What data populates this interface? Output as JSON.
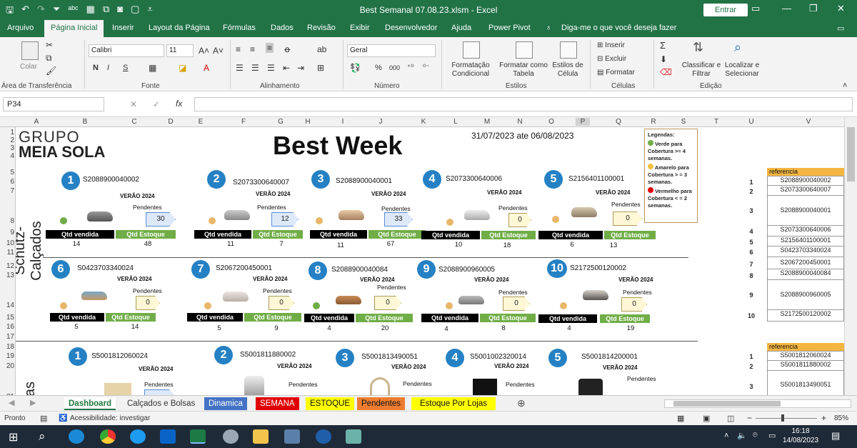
{
  "window": {
    "title": "Best Semanal 07.08.23.xlsm  -  Excel",
    "signin_label": "Entrar"
  },
  "ribbon_tabs": [
    "Arquivo",
    "Página Inicial",
    "Inserir",
    "Layout da Página",
    "Fórmulas",
    "Dados",
    "Revisão",
    "Exibir",
    "Desenvolvedor",
    "Ajuda",
    "Power Pivot"
  ],
  "ribbon_search": "Diga-me o que você deseja fazer",
  "ribbon": {
    "clipboard": {
      "paste_label": "Colar",
      "group": "Área de Transferência"
    },
    "font": {
      "name": "Calibri",
      "size": "11",
      "group": "Fonte",
      "bold": "N",
      "italic": "I",
      "underline": "S"
    },
    "alignment": {
      "group": "Alinhamento"
    },
    "number": {
      "format": "Geral",
      "percent": "%",
      "thousands": "000",
      "group": "Número"
    },
    "styles": {
      "cond_format": "Formatação Condicional",
      "format_table": "Formatar como Tabela",
      "cell_styles": "Estilos de Célula",
      "group": "Estilos"
    },
    "cells": {
      "insert": "Inserir",
      "delete": "Excluir",
      "format": "Formatar",
      "group": "Células"
    },
    "editing": {
      "sort": "Classificar e Filtrar",
      "find": "Localizar e Selecionar",
      "group": "Edição"
    }
  },
  "formula_bar": {
    "name_box": "P34",
    "fx": "fx",
    "content": ""
  },
  "columns": [
    "A",
    "B",
    "C",
    "D",
    "E",
    "F",
    "G",
    "H",
    "I",
    "J",
    "K",
    "L",
    "M",
    "N",
    "O",
    "P",
    "Q",
    "R",
    "S",
    "T",
    "U",
    "V"
  ],
  "rows": [
    "1",
    "2",
    "3",
    "4",
    "5",
    "6",
    "7",
    "8",
    "9",
    "10",
    "11",
    "12",
    "13",
    "14",
    "15",
    "16",
    "17",
    "18",
    "19",
    "20",
    "21"
  ],
  "dashboard": {
    "brand_line1": "GRUPO",
    "brand_line2": "MEIA SOLA",
    "title": "Best Week",
    "period": "31/07/2023 ate 06/08/2023",
    "section_label": "Schutz- Calçados",
    "section_label_bags": "as",
    "legend": {
      "title": "Legendas:",
      "green": "Verde para Cobertura >= 4 semanas.",
      "yellow": "Amarelo para Cobertura > = 3 semanas.",
      "red": "Vermelho para Cobertura < = 2 semanas.",
      "green_color": "#70ad47",
      "yellow_color": "#f5c141",
      "red_color": "#e00000"
    },
    "labels": {
      "verao": "VERÃO 2024",
      "pendentes": "Pendentes",
      "qtd_vendida": "Qtd vendida",
      "qtd_estoque": "Qtd Estoque"
    },
    "shoes_row1": [
      {
        "rank": "1",
        "code": "S2088900040002",
        "pendentes": "30",
        "vendida": "14",
        "estoque": "48",
        "dot": "#70ad47"
      },
      {
        "rank": "2",
        "code": "S2073300640007",
        "pendentes": "12",
        "vendida": "11",
        "estoque": "7",
        "dot": "#e8b76a"
      },
      {
        "rank": "3",
        "code": "S2088900040001",
        "pendentes": "33",
        "vendida": "11",
        "estoque": "67",
        "dot": "#e8b76a"
      },
      {
        "rank": "4",
        "code": "S2073300640006",
        "pendentes": "0",
        "vendida": "10",
        "estoque": "18",
        "dot": "#e8b76a"
      },
      {
        "rank": "5",
        "code": "S2156401100001",
        "pendentes": "0",
        "vendida": "6",
        "estoque": "13",
        "dot": "#e8b76a"
      }
    ],
    "shoes_row2": [
      {
        "rank": "6",
        "code": "S0423703340024",
        "pendentes": "0",
        "vendida": "5",
        "estoque": "14",
        "dot": "#e8b76a"
      },
      {
        "rank": "7",
        "code": "S2067200450001",
        "pendentes": "0",
        "vendida": "5",
        "estoque": "9",
        "dot": "#e8b76a"
      },
      {
        "rank": "8",
        "code": "S2088900040084",
        "pendentes": "0",
        "vendida": "4",
        "estoque": "20",
        "dot": "#70ad47"
      },
      {
        "rank": "9",
        "code": "S2088900960005",
        "pendentes": "0",
        "vendida": "4",
        "estoque": "8",
        "dot": "#e8b76a"
      },
      {
        "rank": "10",
        "code": "S2172500120002",
        "pendentes": "0",
        "vendida": "4",
        "estoque": "19",
        "dot": "#e8b76a"
      }
    ],
    "bags_row1": [
      {
        "rank": "1",
        "code": "S5001812060024"
      },
      {
        "rank": "2",
        "code": "S5001811880002"
      },
      {
        "rank": "3",
        "code": "S5001813490051"
      },
      {
        "rank": "4",
        "code": "S5001002320014"
      },
      {
        "rank": "5",
        "code": "S5001814200001"
      }
    ],
    "ref_table_1": {
      "header": "referencia",
      "rows": [
        {
          "i": "1",
          "ref": "S2088900040002"
        },
        {
          "i": "2",
          "ref": "S2073300640007"
        },
        {
          "i": "3",
          "ref": "S2088900040001"
        },
        {
          "i": "4",
          "ref": "S2073300640006"
        },
        {
          "i": "5",
          "ref": "S2156401100001"
        },
        {
          "i": "6",
          "ref": "S0423703340024"
        },
        {
          "i": "7",
          "ref": "S2067200450001"
        },
        {
          "i": "8",
          "ref": "S2088900040084"
        },
        {
          "i": "9",
          "ref": "S2088900960005"
        },
        {
          "i": "10",
          "ref": "S2172500120002"
        }
      ]
    },
    "ref_table_2": {
      "header": "referencia",
      "rows": [
        {
          "i": "1",
          "ref": "S5001812060024"
        },
        {
          "i": "2",
          "ref": "S5001811880002"
        },
        {
          "i": "3",
          "ref": "S5001813490051"
        }
      ]
    }
  },
  "sheet_tabs": [
    {
      "label": "Dashboard",
      "bg": "#ffffff",
      "fg": "#1e7a3c"
    },
    {
      "label": "Calçados e Bolsas",
      "bg": "#f1f1f1",
      "fg": "#333333"
    },
    {
      "label": "Dinamica",
      "bg": "#4472c4",
      "fg": "#ffffff"
    },
    {
      "label": "SEMANA",
      "bg": "#e00000",
      "fg": "#ffffff"
    },
    {
      "label": "ESTOQUE",
      "bg": "#ffff00",
      "fg": "#111111"
    },
    {
      "label": "Pendentes",
      "bg": "#ed7d31",
      "fg": "#111111"
    },
    {
      "label": "Estoque Por Lojas",
      "bg": "#ffff00",
      "fg": "#111111"
    }
  ],
  "status_bar": {
    "ready": "Pronto",
    "accessibility": "Acessibilidade: investigar",
    "zoom": "85%"
  },
  "taskbar": {
    "time": "16:18",
    "date": "14/08/2023"
  }
}
